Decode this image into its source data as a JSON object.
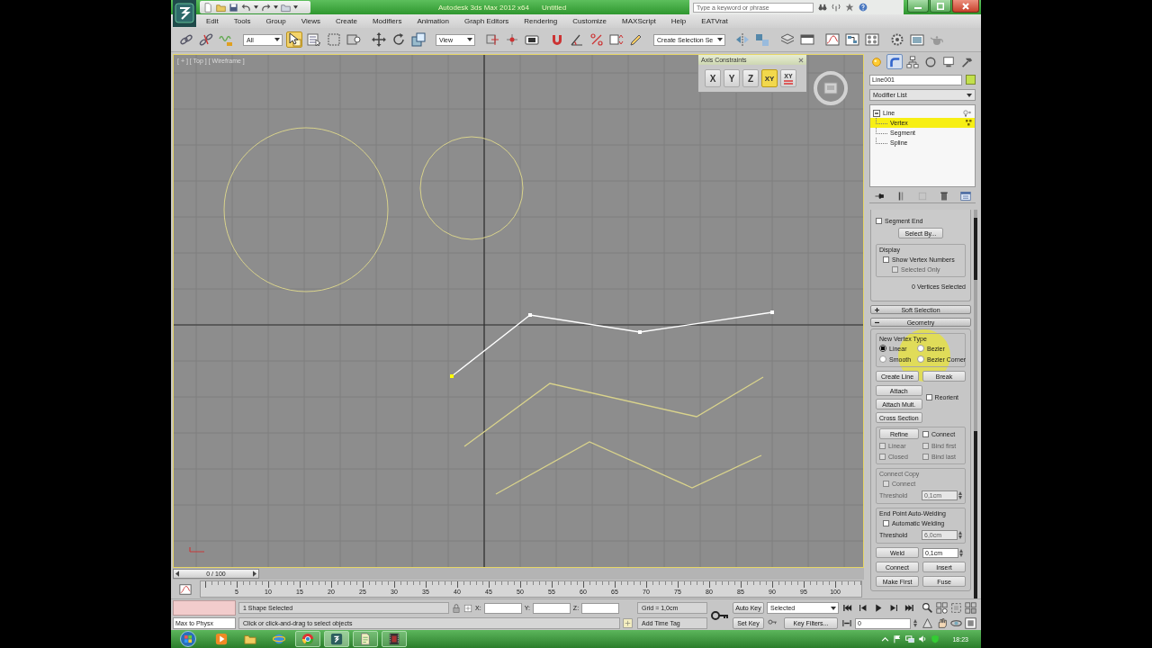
{
  "title_bar": {
    "app_title": "Autodesk 3ds Max 2012 x64",
    "document": "Untitled",
    "search": {
      "placeholder": "Type a keyword or phrase"
    }
  },
  "menu_bar": [
    "Edit",
    "Tools",
    "Group",
    "Views",
    "Create",
    "Modifiers",
    "Animation",
    "Graph Editors",
    "Rendering",
    "Customize",
    "MAXScript",
    "Help",
    "EATVrat"
  ],
  "main_toolbar": [
    {
      "kind": "link",
      "selected": false
    },
    {
      "kind": "unlink",
      "selected": false
    },
    {
      "kind": "bind",
      "selected": false
    },
    {
      "kind": "dropdown",
      "value": "All"
    },
    {
      "kind": "select",
      "selected": true
    },
    {
      "kind": "list",
      "selected": false
    },
    {
      "kind": "region",
      "selected": false
    },
    {
      "kind": "crossing",
      "selected": false
    },
    {
      "kind": "move",
      "selected": false
    },
    {
      "kind": "rotate",
      "selected": false
    },
    {
      "kind": "scale",
      "selected": false
    },
    {
      "kind": "dropdown",
      "value": "View"
    },
    {
      "kind": "pivot",
      "selected": false
    },
    {
      "kind": "manipulate",
      "selected": false
    },
    {
      "kind": "keyboard",
      "selected": false
    },
    {
      "kind": "snap",
      "selected": false
    },
    {
      "kind": "angle",
      "selected": false
    },
    {
      "kind": "percent",
      "selected": false
    },
    {
      "kind": "spinner",
      "selected": false
    },
    {
      "kind": "named",
      "selected": false
    },
    {
      "kind": "dropdown",
      "value": "Create Selection Se"
    },
    {
      "kind": "mirror",
      "selected": false
    },
    {
      "kind": "align",
      "selected": false
    },
    {
      "kind": "layers",
      "selected": false
    },
    {
      "kind": "ribbon",
      "selected": false
    },
    {
      "kind": "curves",
      "selected": false
    },
    {
      "kind": "schematic",
      "selected": false
    },
    {
      "kind": "material",
      "selected": false
    },
    {
      "kind": "setup",
      "selected": false
    },
    {
      "kind": "frame",
      "selected": false
    },
    {
      "kind": "teapot",
      "selected": false
    }
  ],
  "viewport": {
    "label": "[ + ] [ Top ] [ Wireframe ]",
    "shapes": [
      {
        "kind": "circle",
        "selected": false
      },
      {
        "kind": "circle",
        "selected": false
      },
      {
        "kind": "line",
        "selected": true
      },
      {
        "kind": "line",
        "selected": false
      },
      {
        "kind": "line",
        "selected": false
      }
    ],
    "axis_constraints": {
      "title": "Axis Constraints",
      "buttons": [
        {
          "label": "X",
          "kind": "axis",
          "selected": false
        },
        {
          "label": "Y",
          "kind": "axis",
          "selected": false
        },
        {
          "label": "Z",
          "kind": "axis",
          "selected": false
        },
        {
          "label": "XY",
          "kind": "axis",
          "selected": true
        },
        {
          "label": "XY",
          "kind": "cycle",
          "selected": false
        }
      ]
    }
  },
  "command_panel": {
    "tabs": [
      {
        "kind": "create",
        "selected": false
      },
      {
        "kind": "modify",
        "selected": true
      },
      {
        "kind": "hierarchy",
        "selected": false
      },
      {
        "kind": "motion",
        "selected": false
      },
      {
        "kind": "display",
        "selected": false
      },
      {
        "kind": "utilities",
        "selected": false
      }
    ],
    "object_name": "Line001",
    "modifier_list": "Modifier List",
    "stack": [
      {
        "label": "Line",
        "selected": false,
        "expanded": true,
        "children": [
          {
            "label": "Vertex",
            "selected": true
          },
          {
            "label": "Segment",
            "selected": false
          },
          {
            "label": "Spline",
            "selected": false
          }
        ]
      }
    ],
    "selection": {
      "segment_end": {
        "label": "Segment End",
        "checked": false
      },
      "select_by": "Select By...",
      "display": {
        "title": "Display",
        "show_vertex_numbers": {
          "label": "Show Vertex Numbers",
          "checked": false
        },
        "selected_only": {
          "label": "Selected Only",
          "checked": false,
          "disabled": true
        }
      },
      "status": "0 Vertices Selected"
    },
    "rollouts": [
      {
        "title": "Soft Selection",
        "expanded": false
      },
      {
        "title": "Geometry",
        "expanded": true,
        "content": {
          "new_vertex_type": {
            "title": "New Vertex Type",
            "options": [
              {
                "label": "Linear",
                "selected": true
              },
              {
                "label": "Bezier",
                "selected": false
              },
              {
                "label": "Smooth",
                "selected": false
              },
              {
                "label": "Bezier Corner",
                "selected": false
              }
            ]
          },
          "create_line": "Create Line",
          "break": "Break",
          "attach": "Attach",
          "reorient": {
            "label": "Reorient",
            "checked": false
          },
          "attach_mult": "Attach Mult.",
          "cross_section": "Cross Section",
          "refine": {
            "button": "Refine",
            "connect": {
              "label": "Connect",
              "checked": false
            },
            "options": [
              {
                "label": "Linear",
                "checked": false,
                "disabled": true
              },
              {
                "label": "Bind first",
                "checked": false,
                "disabled": true
              },
              {
                "label": "Closed",
                "checked": false,
                "disabled": true
              },
              {
                "label": "Bind last",
                "checked": false,
                "disabled": true
              }
            ]
          },
          "connect_copy": {
            "title": "Connect Copy",
            "disabled": true,
            "connect": {
              "label": "Connect",
              "checked": false
            },
            "threshold": {
              "label": "Threshold",
              "value": "0,1cm"
            }
          },
          "auto_weld": {
            "title": "End Point Auto-Welding",
            "automatic": {
              "label": "Automatic Welding",
              "checked": false
            },
            "threshold": {
              "label": "Threshold",
              "value": "6,0cm",
              "disabled": true
            }
          },
          "weld": {
            "button": "Weld",
            "value": "0,1cm"
          },
          "buttons": [
            "Connect",
            "Insert",
            "Make First",
            "Fuse"
          ]
        }
      }
    ]
  },
  "time_slider": {
    "label": "0 / 100",
    "level": 0
  },
  "track_bar": {
    "ticks": [
      "5",
      "10",
      "15",
      "20",
      "25",
      "30",
      "35",
      "40",
      "45",
      "50",
      "55",
      "60",
      "65",
      "70",
      "75",
      "80",
      "85",
      "90",
      "95",
      "100"
    ]
  },
  "status_bar": {
    "listener_output": "Max to Physx",
    "selection": "1 Shape Selected",
    "coordinates": [
      "X:",
      "Y:",
      "Z:"
    ],
    "prompt": "Click or click-and-drag to select objects",
    "grid": "Grid = 1,0cm",
    "time_tag": "Add Time Tag"
  },
  "animation_controls": {
    "auto_key": {
      "label": "Auto Key",
      "on": false
    },
    "key_mode": "Selected",
    "set_key": "Set Key",
    "key_filters": "Key Filters...",
    "frame": "0"
  },
  "taskbar": {
    "apps": [
      {
        "kind": "media",
        "running": false,
        "selected": false
      },
      {
        "kind": "folder",
        "running": false,
        "selected": false
      },
      {
        "kind": "globe",
        "running": false,
        "selected": false
      },
      {
        "kind": "wheel",
        "running": true,
        "selected": false
      },
      {
        "kind": "app",
        "running": true,
        "selected": true
      },
      {
        "kind": "document",
        "running": true,
        "selected": false
      },
      {
        "kind": "film",
        "running": true,
        "selected": false
      }
    ],
    "clock": "18:23"
  }
}
